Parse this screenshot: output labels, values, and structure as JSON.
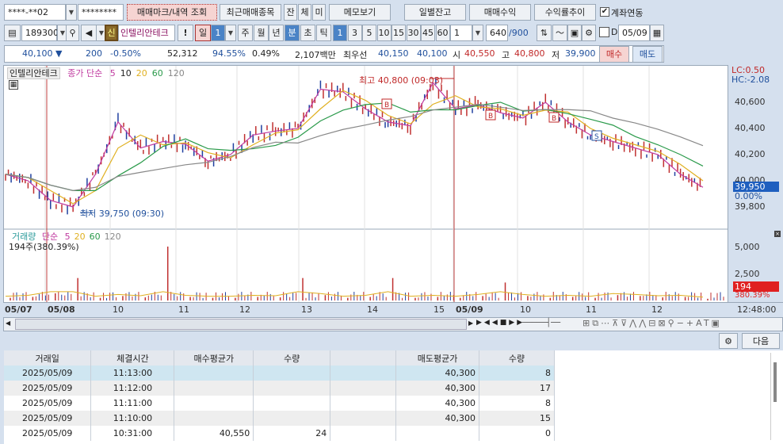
{
  "top": {
    "account": "****-**02",
    "password": "********",
    "btn_trade_mark": "매매마크/내역 조회",
    "btn_recent": "최근매매종목",
    "btn_jan": "잔",
    "btn_che": "체",
    "btn_mi": "미",
    "btn_memo": "메모보기",
    "btn_daily": "일별잔고",
    "btn_profit": "매매수익",
    "btn_trend": "수익률추이",
    "link_label": "계좌연동",
    "link_checked": true
  },
  "toolbar": {
    "code": "189300",
    "shin": "신",
    "stock_name": "인텔리안테크",
    "excl": "!",
    "day": "일",
    "day_num": "1",
    "periods": [
      "주",
      "월",
      "년",
      "분",
      "초",
      "틱"
    ],
    "minutes": [
      "1",
      "3",
      "5",
      "10",
      "15",
      "30",
      "45",
      "60"
    ],
    "interval": "1",
    "count": "640",
    "count_max": "/900",
    "d_label": "D",
    "date": "05/09"
  },
  "quote": {
    "price": "40,100",
    "arrow": "▼",
    "change": "200",
    "pct": "-0.50%",
    "volume": "52,312",
    "ratio": "94.55%",
    "turnover": "0.49%",
    "amount": "2,107백만",
    "best_label": "최우선",
    "best_ask": "40,150",
    "best_bid": "40,100",
    "open_label": "시",
    "open": "40,550",
    "high_label": "고",
    "high": "40,800",
    "low_label": "저",
    "low": "39,900",
    "buy": "매수",
    "sell": "매도"
  },
  "chart": {
    "title": "인텔리안테크",
    "ma_label": "종가 단순",
    "ma": [
      "5",
      "10",
      "20",
      "60",
      "120"
    ],
    "ma_colors": [
      "#c03aa0",
      "#222222",
      "#e0b020",
      "#2a9a4a",
      "#888888"
    ],
    "high_note": "최고 40,800 (09:03)",
    "low_note": "최저 39,750 (09:30)",
    "lc": "LC:0.50",
    "hc": "HC:-2.08",
    "yticks": [
      "40,600",
      "40,400",
      "40,200",
      "40,000",
      "39,800"
    ],
    "cur_price": "39,950",
    "cur_pct": "0.00%",
    "vol_title": "거래량",
    "vol_ma_label": "단순",
    "vol_ma": [
      "5",
      "20",
      "60",
      "120"
    ],
    "vol_info": "194주(380.39%)",
    "vol_ticks": [
      "5,000",
      "2,500"
    ],
    "vol_cur": "194",
    "vol_pct": "380.39%",
    "time_labels": [
      "05/07",
      "05/08",
      "10",
      "11",
      "12",
      "13",
      "14",
      "15",
      "05/09",
      "10",
      "11",
      "12"
    ],
    "time_now": "12:48:00",
    "prices": [
      40050,
      40000,
      39850,
      39800,
      40050,
      40450,
      40250,
      40300,
      40280,
      40150,
      40200,
      40350,
      40380,
      40400,
      40700,
      40680,
      40550,
      40450,
      40420,
      40750,
      40550,
      40580,
      40520,
      40480,
      40600,
      40450,
      40350,
      40300,
      40250,
      40200,
      40050,
      39950
    ],
    "volumes": [
      300,
      400,
      800,
      2500,
      300,
      500,
      350,
      6000,
      400,
      300,
      300,
      400,
      350,
      2500,
      600,
      300,
      400,
      2500,
      300,
      400,
      300,
      500,
      2000,
      500,
      300,
      400,
      300,
      600,
      500,
      350,
      400,
      194
    ],
    "next": "다음"
  },
  "table": {
    "headers": [
      "거래일",
      "체결시간",
      "매수평균가",
      "수량",
      "",
      "매도평균가",
      "수량"
    ],
    "rows": [
      [
        "2025/05/09",
        "11:13:00",
        "",
        "",
        "",
        "40,300",
        "8"
      ],
      [
        "2025/05/09",
        "11:12:00",
        "",
        "",
        "",
        "40,300",
        "17"
      ],
      [
        "2025/05/09",
        "11:11:00",
        "",
        "",
        "",
        "40,300",
        "8"
      ],
      [
        "2025/05/09",
        "11:10:00",
        "",
        "",
        "",
        "40,300",
        "15"
      ],
      [
        "2025/05/09",
        "10:31:00",
        "40,550",
        "24",
        "",
        "",
        "0"
      ]
    ]
  }
}
